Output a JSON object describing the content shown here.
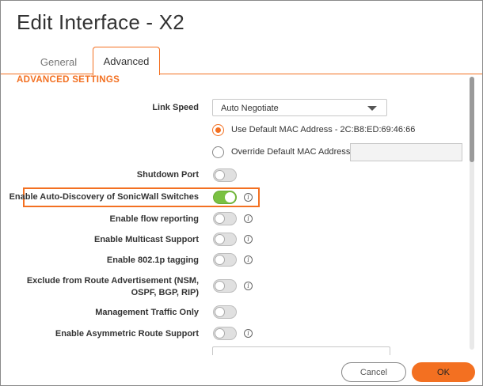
{
  "dialog": {
    "title": "Edit Interface - X2",
    "tabs": [
      {
        "label": "General",
        "active": false
      },
      {
        "label": "Advanced",
        "active": true
      }
    ],
    "section_title": "ADVANCED SETTINGS"
  },
  "link_speed": {
    "label": "Link Speed",
    "value": "Auto Negotiate"
  },
  "mac": {
    "default_label": "Use Default MAC Address  - 2C:B8:ED:69:46:66",
    "default_selected": true,
    "override_label": "Override Default MAC Address",
    "override_value": ""
  },
  "settings": [
    {
      "label": "Shutdown Port",
      "on": false,
      "info": false
    },
    {
      "label": "Enable Auto-Discovery of SonicWall Switches",
      "on": true,
      "info": true
    },
    {
      "label": "Enable flow reporting",
      "on": false,
      "info": true
    },
    {
      "label": "Enable Multicast Support",
      "on": false,
      "info": true
    },
    {
      "label": "Enable 802.1p tagging",
      "on": false,
      "info": true
    },
    {
      "label": "Exclude from Route Advertisement (NSM, OSPF, BGP, RIP)",
      "on": false,
      "info": true
    },
    {
      "label": "Management Traffic Only",
      "on": false,
      "info": false
    },
    {
      "label": "Enable Asymmetric Route Support",
      "on": false,
      "info": true
    }
  ],
  "icons": {
    "info": "info-icon",
    "dropdown": "chevron-down-icon"
  },
  "buttons": {
    "cancel": "Cancel",
    "ok": "OK"
  },
  "colors": {
    "accent": "#f37021",
    "toggle_on": "#7ac142"
  }
}
